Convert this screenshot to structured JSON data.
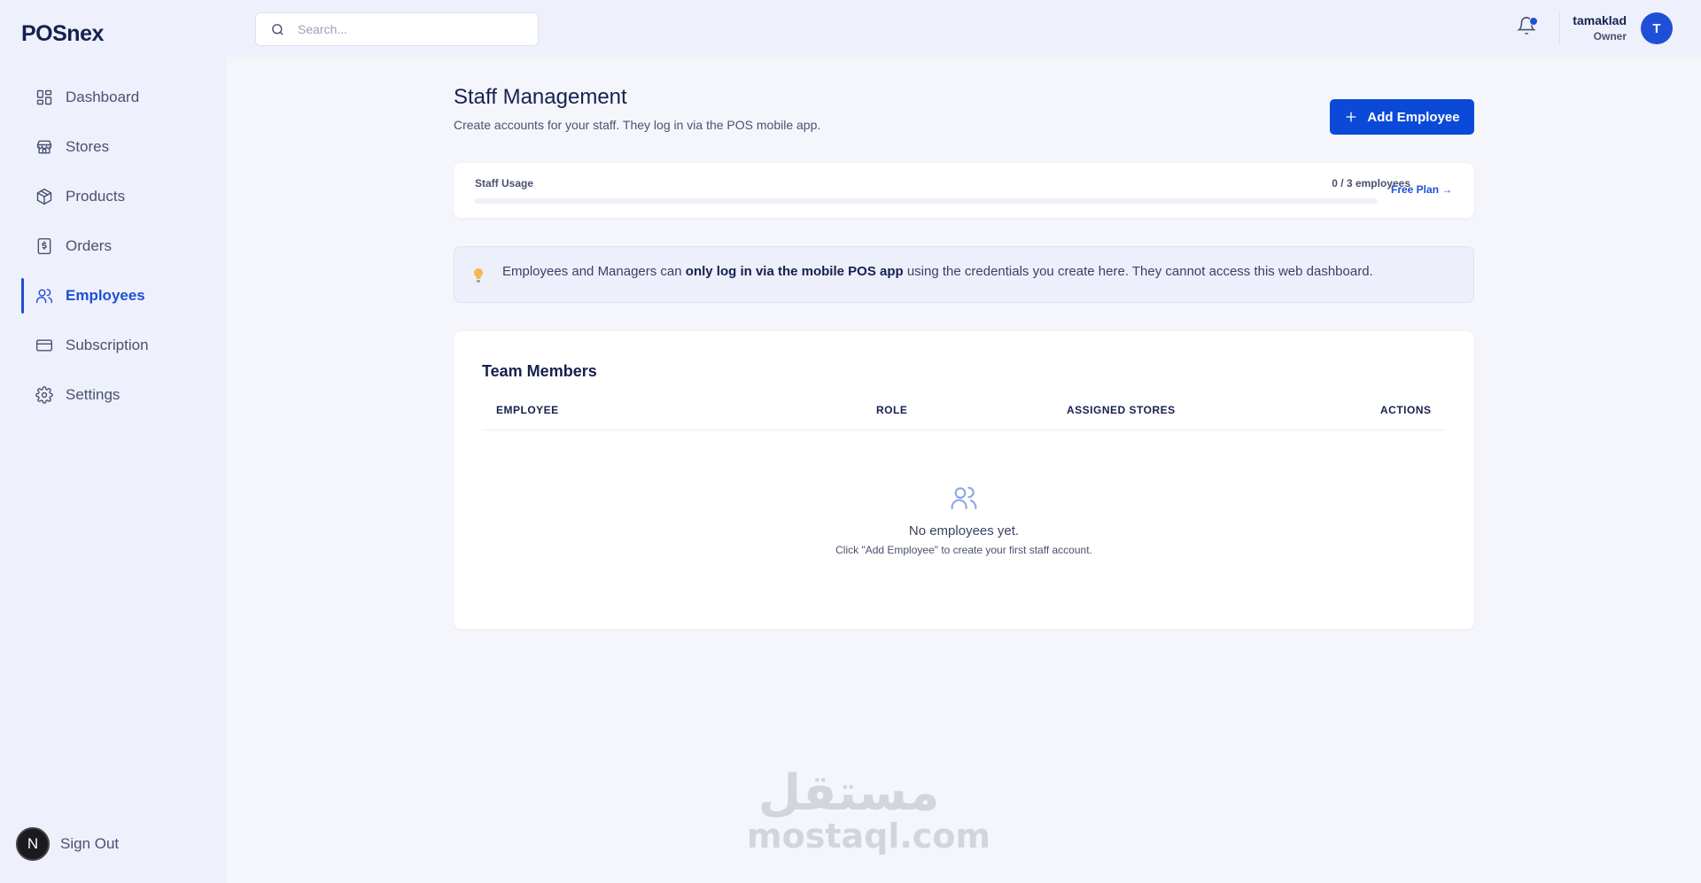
{
  "app": {
    "brand": "POSnex"
  },
  "sidebar": {
    "items": [
      {
        "label": "Dashboard",
        "icon": "dashboard-icon"
      },
      {
        "label": "Stores",
        "icon": "store-icon"
      },
      {
        "label": "Products",
        "icon": "box-icon"
      },
      {
        "label": "Orders",
        "icon": "receipt-icon"
      },
      {
        "label": "Employees",
        "icon": "users-icon",
        "active": true
      },
      {
        "label": "Subscription",
        "icon": "credit-card-icon"
      },
      {
        "label": "Settings",
        "icon": "gear-icon"
      }
    ],
    "signout": {
      "label": "Sign Out",
      "badge": "N"
    }
  },
  "topbar": {
    "search_placeholder": "Search...",
    "user": {
      "name": "tamaklad",
      "role": "Owner",
      "initial": "T"
    }
  },
  "page": {
    "title": "Staff Management",
    "subtitle": "Create accounts for your staff. They log in via the POS mobile app.",
    "add_button": "Add Employee"
  },
  "usage": {
    "label": "Staff Usage",
    "count": "0 / 3 employees",
    "used": 0,
    "limit": 3,
    "plan_link": "Free Plan →"
  },
  "info": {
    "prefix": "Employees and Managers can ",
    "bold": "only log in via the mobile POS app",
    "suffix": " using the credentials you create here. They cannot access this web dashboard."
  },
  "team": {
    "title": "Team Members",
    "columns": [
      "EMPLOYEE",
      "ROLE",
      "ASSIGNED STORES",
      "ACTIONS"
    ],
    "empty_title": "No employees yet.",
    "empty_hint": "Click \"Add Employee\" to create your first staff account."
  },
  "watermark": {
    "arabic": "مستقل",
    "latin": "mostaql.com"
  },
  "colors": {
    "accent": "#1f4fd6",
    "button": "#0b4ad8",
    "sidebar_bg": "#eef0fb",
    "page_bg": "#f5f6fc",
    "text_dark": "#16214f"
  }
}
